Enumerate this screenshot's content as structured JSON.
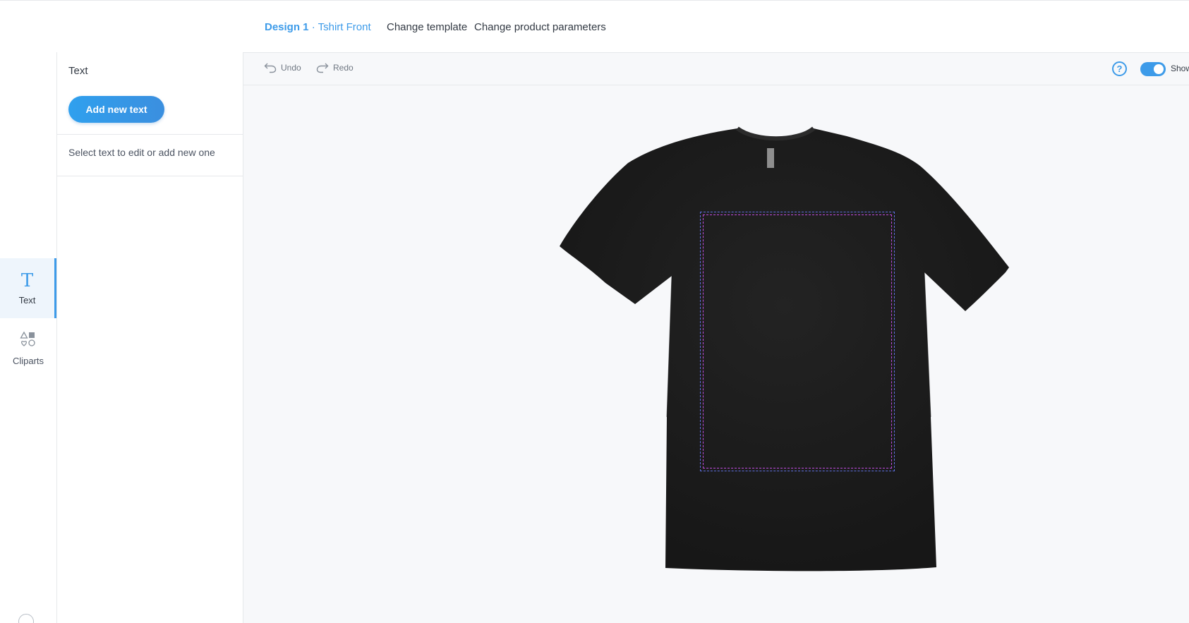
{
  "header": {
    "design_name": "Design 1",
    "separator": "·",
    "template_name": "Tshirt Front",
    "change_template": "Change template",
    "change_params": "Change product parameters"
  },
  "toolbar": {
    "undo": "Undo",
    "redo": "Redo",
    "help": "?",
    "show_label": "Show",
    "toggle_on": true
  },
  "rail": {
    "items": [
      {
        "label": "Text",
        "icon": "text-T-icon",
        "glyph": "T",
        "active": true
      },
      {
        "label": "Cliparts",
        "icon": "shapes-icon",
        "active": false
      }
    ]
  },
  "panel": {
    "title": "Text",
    "add_button": "Add new text",
    "hint": "Select text to edit or add new one"
  },
  "canvas": {
    "product": "Tshirt",
    "product_color": "#1c1c1c",
    "print_area": "dashed"
  },
  "colors": {
    "accent": "#3d9be9",
    "background": "#f7f8fa",
    "border": "#e6e8eb",
    "print_area_outer": "#5d6fe0",
    "print_area_inner": "#c04ce0"
  }
}
